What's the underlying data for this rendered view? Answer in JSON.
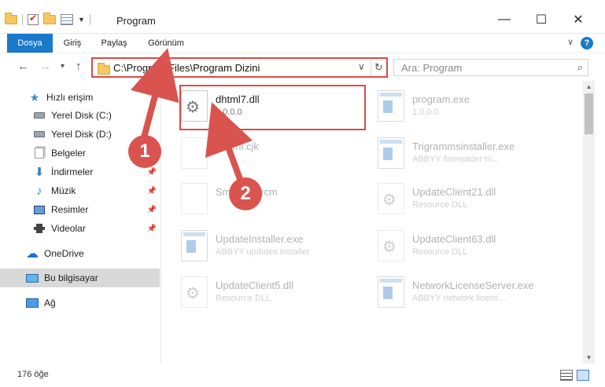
{
  "window": {
    "title": "Program",
    "minimize": "—",
    "maximize": "☐",
    "close": "✕"
  },
  "ribbon": {
    "tabs": [
      "Dosya",
      "Giriş",
      "Paylaş",
      "Görünüm"
    ],
    "help": "?"
  },
  "nav": {
    "back": "←",
    "forward": "→",
    "recent": "▾",
    "up": "↑",
    "address": "C:\\Program Files\\Program Dizini",
    "refresh": "↻",
    "search_placeholder": "Ara: Program",
    "search_icon": "⌕"
  },
  "sidebar": {
    "items": [
      {
        "label": "Hızlı erişim",
        "icon": "star-icon",
        "pinned": false
      },
      {
        "label": "Yerel Disk (C:)",
        "icon": "drive-icon",
        "pinned": false
      },
      {
        "label": "Yerel Disk (D:)",
        "icon": "drive-icon",
        "pinned": false
      },
      {
        "label": "Belgeler",
        "icon": "documents-icon",
        "pinned": false
      },
      {
        "label": "İndirmeler",
        "icon": "download-icon",
        "pinned": true
      },
      {
        "label": "Müzik",
        "icon": "music-icon",
        "pinned": true
      },
      {
        "label": "Resimler",
        "icon": "pictures-icon",
        "pinned": true
      },
      {
        "label": "Videolar",
        "icon": "videos-icon",
        "pinned": true
      },
      {
        "label": "OneDrive",
        "icon": "cloud-icon",
        "pinned": false
      },
      {
        "label": "Bu bilgisayar",
        "icon": "computer-icon",
        "pinned": false,
        "selected": true
      },
      {
        "label": "Ağ",
        "icon": "network-icon",
        "pinned": false
      }
    ]
  },
  "files": [
    {
      "name": "dhtml7.dll",
      "sub": "1.0.0.0",
      "type": "dll",
      "faded": false
    },
    {
      "name": "program.exe",
      "sub": "1.0.0.0",
      "type": "exe",
      "faded": true
    },
    {
      "name": "...html.cjk",
      "sub": "",
      "type": "blank",
      "faded": true
    },
    {
      "name": "Trigrammsinstaller.exe",
      "sub": "ABBYY finereader tri...",
      "type": "exe",
      "faded": true
    },
    {
      "name": "Sm...FIS.ecm",
      "sub": "",
      "type": "blank",
      "faded": true
    },
    {
      "name": "UpdateClient21.dll",
      "sub": "Resource DLL",
      "type": "dll",
      "faded": true
    },
    {
      "name": "UpdateInstaller.exe",
      "sub": "ABBYY updates installer",
      "type": "exe",
      "faded": true
    },
    {
      "name": "UpdateClient63.dll",
      "sub": "Resource DLL",
      "type": "dll",
      "faded": true
    },
    {
      "name": "UpdateClient5.dll",
      "sub": "Resource DLL",
      "type": "dll",
      "faded": true
    },
    {
      "name": "NetworkLicenseServer.exe",
      "sub": "ABBYY network licens...",
      "type": "exe",
      "faded": true
    }
  ],
  "status": {
    "count": "176 öğe"
  },
  "callouts": [
    "1",
    "2"
  ],
  "colors": {
    "accent": "#1979ca",
    "highlight": "#d94a4a",
    "selected": "#d9d9d9"
  }
}
